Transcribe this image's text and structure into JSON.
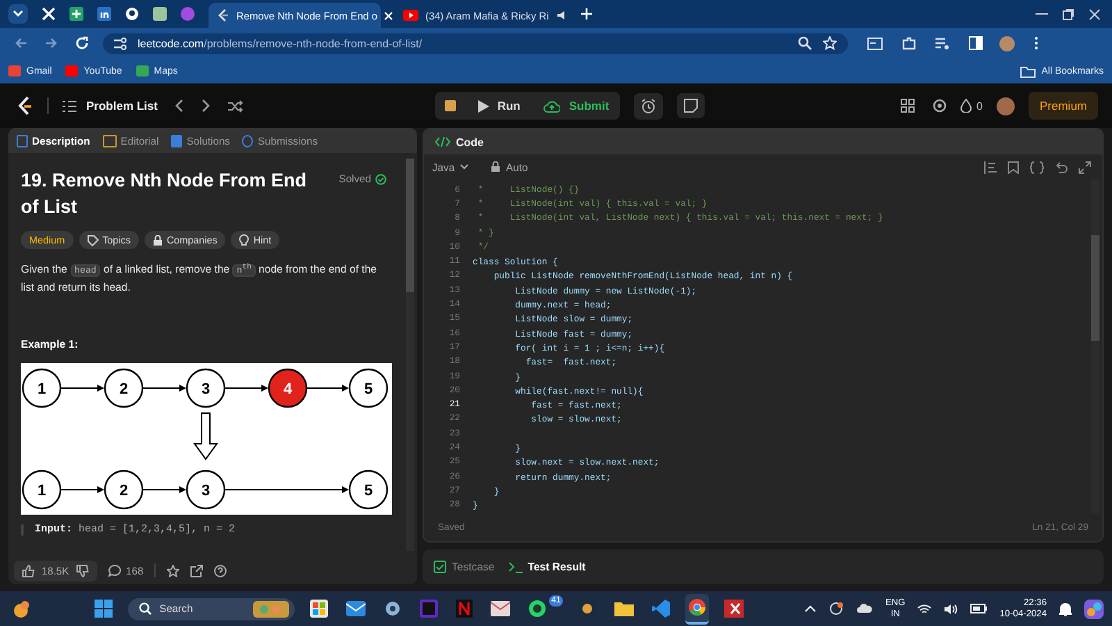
{
  "browser": {
    "tabs": [
      {
        "title": "Remove Nth Node From End o",
        "kind": "leetcode",
        "selected": true
      },
      {
        "title": "(34) Aram Mafia & Ricky Ri",
        "kind": "youtube",
        "selected": false
      }
    ],
    "address_bar": {
      "host": "leetcode.com",
      "path": "/problems/remove-nth-node-from-end-of-list/"
    },
    "bookmarks": [
      {
        "label": "Gmail",
        "kind": "gmail"
      },
      {
        "label": "YouTube",
        "kind": "youtube"
      },
      {
        "label": "Maps",
        "kind": "maps"
      }
    ],
    "all_bookmarks": "All Bookmarks"
  },
  "header": {
    "problem_list": "Problem List",
    "run": "Run",
    "submit": "Submit",
    "streak": "0",
    "premium": "Premium"
  },
  "left_panel": {
    "tabs": [
      {
        "label": "Description",
        "selected": true
      },
      {
        "label": "Editorial",
        "selected": false
      },
      {
        "label": "Solutions",
        "selected": false
      },
      {
        "label": "Submissions",
        "selected": false
      }
    ],
    "title": "19. Remove Nth Node From End of List",
    "status": "Solved",
    "tags": [
      {
        "label": "Medium",
        "kind": "difficulty"
      },
      {
        "label": "Topics",
        "kind": "topics"
      },
      {
        "label": "Companies",
        "kind": "companies"
      },
      {
        "label": "Hint",
        "kind": "hint"
      }
    ],
    "description": [
      {
        "text": "Given the ",
        "kind": "text"
      },
      {
        "text": "head",
        "kind": "code"
      },
      {
        "text": " of a linked list, remove the ",
        "kind": "text"
      },
      {
        "text": "n$^{th}$",
        "kind": "code"
      },
      {
        "text": " node from the end of the list and return its head.",
        "kind": "text"
      }
    ],
    "example_heading": "Example 1:",
    "diagram": {
      "rows": [
        {
          "nodes": [
            {
              "label": "1",
              "highlighted": false
            },
            {
              "label": "2",
              "highlighted": false
            },
            {
              "label": "3",
              "highlighted": false
            },
            {
              "label": "4",
              "highlighted": true
            },
            {
              "label": "5",
              "highlighted": false
            }
          ]
        },
        {
          "nodes": [
            {
              "label": "1",
              "highlighted": false
            },
            {
              "label": "2",
              "highlighted": false
            },
            {
              "label": "3",
              "highlighted": false
            },
            {
              "label": "5",
              "highlighted": false,
              "gap_before": true
            }
          ]
        }
      ]
    },
    "input_label": "Input:",
    "input_value": "head = [1,2,3,4,5], n = 2",
    "likes": "18.5K",
    "comments": "168"
  },
  "editor": {
    "title": "Code",
    "language": "Java",
    "mode": "Auto",
    "lines": [
      {
        "number": "6",
        "text": " *     ListNode() {}",
        "kind": "comment",
        "current": false
      },
      {
        "number": "7",
        "text": " *     ListNode(int val) { this.val = val; }",
        "kind": "comment",
        "current": false
      },
      {
        "number": "8",
        "text": " *     ListNode(int val, ListNode next) { this.val = val; this.next = next; }",
        "kind": "comment",
        "current": false
      },
      {
        "number": "9",
        "text": " * }",
        "kind": "comment",
        "current": false
      },
      {
        "number": "10",
        "text": " */",
        "kind": "comment",
        "current": false
      },
      {
        "number": "11",
        "text": "class Solution {",
        "kind": "code",
        "current": false
      },
      {
        "number": "12",
        "text": "    public ListNode removeNthFromEnd(ListNode head, int n) {",
        "kind": "code",
        "current": false
      },
      {
        "number": "13",
        "text": "        ListNode dummy = new ListNode(-1);",
        "kind": "code",
        "current": false
      },
      {
        "number": "14",
        "text": "        dummy.next = head;",
        "kind": "code",
        "current": false
      },
      {
        "number": "15",
        "text": "        ListNode slow = dummy;",
        "kind": "code",
        "current": false
      },
      {
        "number": "16",
        "text": "        ListNode fast = dummy;",
        "kind": "code",
        "current": false
      },
      {
        "number": "17",
        "text": "        for( int i = 1 ; i<=n; i++){",
        "kind": "code",
        "current": false
      },
      {
        "number": "18",
        "text": "          fast=  fast.next;",
        "kind": "code",
        "current": false
      },
      {
        "number": "19",
        "text": "        }",
        "kind": "code",
        "current": false
      },
      {
        "number": "20",
        "text": "        while(fast.next!= null){",
        "kind": "code",
        "current": false
      },
      {
        "number": "21",
        "text": "           fast = fast.next;",
        "kind": "code",
        "current": true
      },
      {
        "number": "22",
        "text": "           slow = slow.next;",
        "kind": "code",
        "current": false
      },
      {
        "number": "23",
        "current": false
      },
      {
        "number": "24",
        "text": "        }",
        "kind": "code",
        "current": false
      },
      {
        "number": "25",
        "text": "        slow.next = slow.next.next;",
        "kind": "code",
        "current": false
      },
      {
        "number": "26",
        "text": "        return dummy.next;",
        "kind": "code",
        "current": false
      },
      {
        "number": "27",
        "text": "    }",
        "kind": "code",
        "current": false
      },
      {
        "number": "28",
        "text": "}",
        "kind": "code",
        "current": false
      }
    ],
    "status": "Saved",
    "cursor": "Ln 21, Col 29"
  },
  "bottom_tabs": [
    {
      "label": "Testcase",
      "selected": false
    },
    {
      "label": "Test Result",
      "selected": true
    }
  ],
  "taskbar": {
    "search": "Search",
    "whatsapp_badge": "41",
    "language": "ENG",
    "region": "IN",
    "time": "22:36",
    "date": "10-04-2024"
  }
}
